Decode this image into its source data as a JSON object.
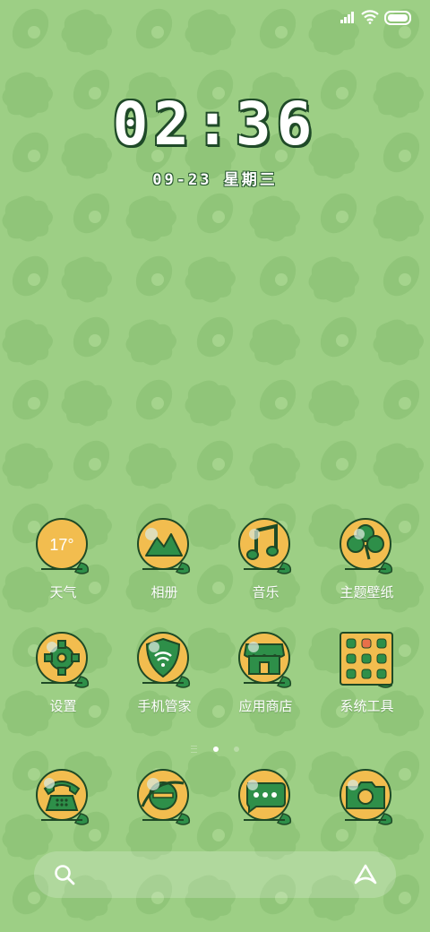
{
  "status_bar": {
    "signal_icon": "signal-bars-icon",
    "wifi_icon": "wifi-icon",
    "battery_icon": "battery-icon"
  },
  "lockscreen": {
    "time": "02:36",
    "date": "09-23 星期三"
  },
  "apps_row1": [
    {
      "label": "天气",
      "icon": "weather-icon",
      "text": "17°"
    },
    {
      "label": "相册",
      "icon": "gallery-icon"
    },
    {
      "label": "音乐",
      "icon": "music-icon"
    },
    {
      "label": "主题壁纸",
      "icon": "clover-icon"
    }
  ],
  "apps_row2": [
    {
      "label": "设置",
      "icon": "gear-icon"
    },
    {
      "label": "手机管家",
      "icon": "shield-icon"
    },
    {
      "label": "应用商店",
      "icon": "store-icon"
    },
    {
      "label": "系统工具",
      "icon": "folder-icon"
    }
  ],
  "dock": [
    {
      "icon": "phone-icon"
    },
    {
      "icon": "browser-icon"
    },
    {
      "icon": "messages-icon"
    },
    {
      "icon": "camera-icon"
    }
  ],
  "page_indicator": {
    "pages": 3,
    "current": 2
  },
  "search_bar": {
    "search_icon": "search-icon",
    "assistant_icon": "assistant-icon"
  },
  "colors": {
    "background": "#9dcf85",
    "icon_fill": "#f2bd4f",
    "icon_outline": "#1e4a26",
    "icon_glyph": "#2e8f49"
  }
}
